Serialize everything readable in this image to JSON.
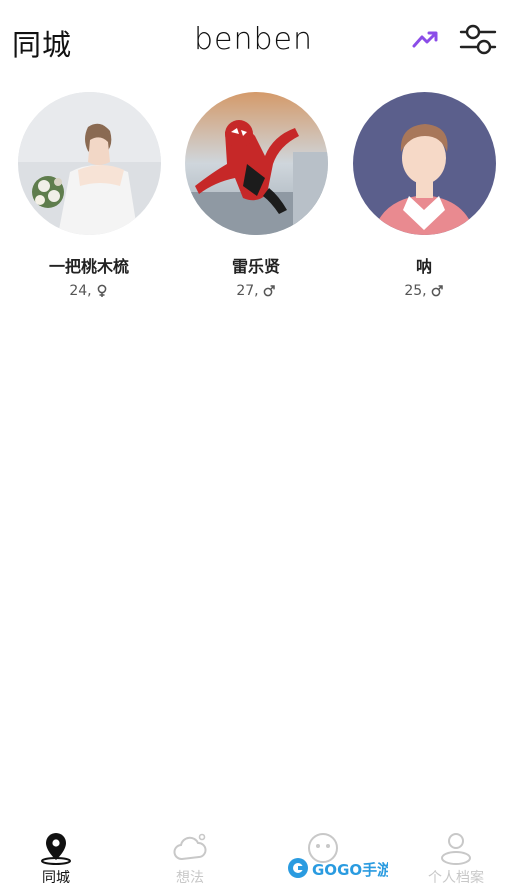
{
  "header": {
    "title": "同城",
    "logo": "benben",
    "trend_icon": "trending-up-icon",
    "filter_icon": "sliders-icon"
  },
  "users": [
    {
      "name": "一把桃木梳",
      "age": "24,",
      "gender": "female",
      "gender_icon": "female-icon"
    },
    {
      "name": "雷乐贤",
      "age": "27,",
      "gender": "male",
      "gender_icon": "male-icon"
    },
    {
      "name": "呐",
      "age": "25,",
      "gender": "male",
      "gender_icon": "male-icon"
    }
  ],
  "tabs": [
    {
      "label": "同城",
      "icon": "location-pin-icon",
      "active": true
    },
    {
      "label": "想法",
      "icon": "cloud-icon",
      "active": false
    },
    {
      "label": "",
      "icon": "chat-bubble-icon",
      "active": false
    },
    {
      "label": "个人档案",
      "icon": "profile-icon",
      "active": false
    }
  ],
  "watermark": {
    "text": "GOGO手游网"
  },
  "colors": {
    "accent": "#8b4de8",
    "active_tab": "#111111",
    "inactive_tab": "#c8c8c8"
  }
}
